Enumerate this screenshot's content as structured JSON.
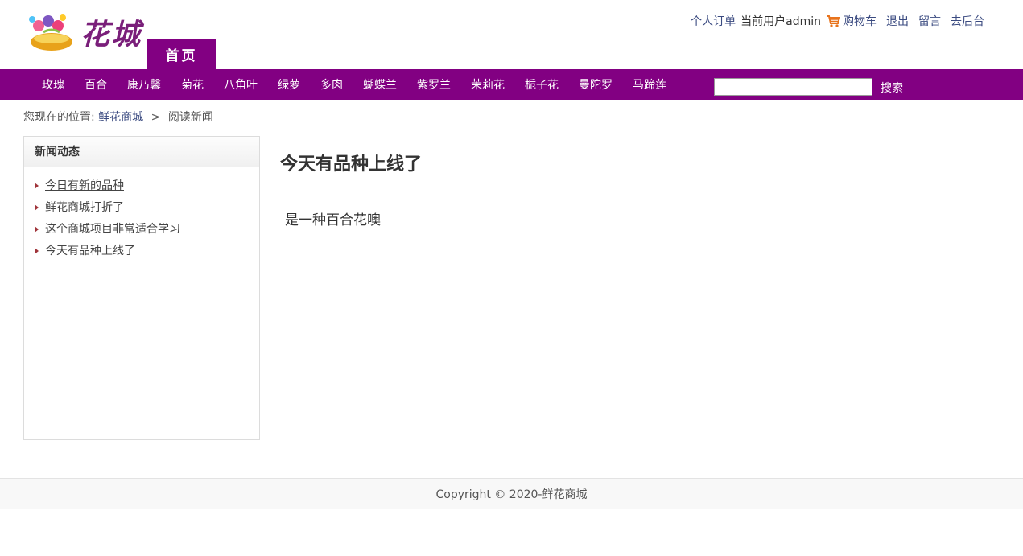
{
  "header": {
    "logo_text": "花城",
    "home_tab": "首页",
    "links": {
      "orders": "个人订单",
      "current_user": "当前用户admin",
      "cart": "购物车",
      "logout": "退出",
      "message": "留言",
      "admin": "去后台"
    }
  },
  "nav": {
    "items": [
      "玫瑰",
      "百合",
      "康乃馨",
      "菊花",
      "八角叶",
      "绿萝",
      "多肉",
      "蝴蝶兰",
      "紫罗兰",
      "茉莉花",
      "栀子花",
      "曼陀罗",
      "马蹄莲"
    ],
    "search_value": "",
    "search_button": "搜索"
  },
  "breadcrumb": {
    "prefix": "您现在的位置:",
    "home": "鲜花商城",
    "separator": ">",
    "current": "阅读新闻"
  },
  "sidebar": {
    "title": "新闻动态",
    "items": [
      "今日有新的品种",
      "鲜花商城打折了",
      "这个商城项目非常适合学习",
      "今天有品种上线了"
    ]
  },
  "article": {
    "title": "今天有品种上线了",
    "body": "是一种百合花噢"
  },
  "footer": {
    "copyright": "Copyright © 2020-鲜花商城"
  },
  "colors": {
    "brand": "#820082",
    "link": "#3a4a80"
  }
}
